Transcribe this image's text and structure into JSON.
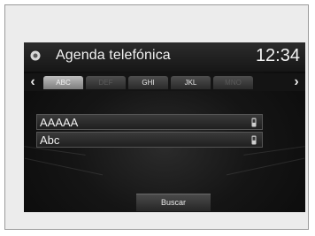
{
  "header": {
    "title": "Agenda telefónica",
    "clock": "12:34",
    "home_icon": "home-icon"
  },
  "tabs": [
    {
      "label": "ABC",
      "active": true,
      "enabled": true
    },
    {
      "label": "DEF",
      "active": false,
      "enabled": false
    },
    {
      "label": "GHI",
      "active": false,
      "enabled": true
    },
    {
      "label": "JKL",
      "active": false,
      "enabled": true
    },
    {
      "label": "MNO",
      "active": false,
      "enabled": false
    }
  ],
  "contacts": [
    {
      "name": "AAAAA",
      "icon": "phone-icon"
    },
    {
      "name": "Abc",
      "icon": "phone-icon"
    }
  ],
  "search_button": {
    "label": "Buscar"
  },
  "colors": {
    "screen_bg": "#090909",
    "active_tab": "#bfbfbf",
    "text": "#f2f2f2"
  }
}
